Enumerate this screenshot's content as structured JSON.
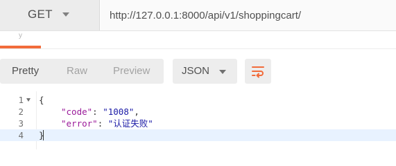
{
  "request": {
    "method": "GET",
    "url": "http://127.0.0.1:8000/api/v1/shoppingcart/"
  },
  "tabs": {
    "fragment": "y"
  },
  "toolbar": {
    "formats": [
      "Pretty",
      "Raw",
      "Preview"
    ],
    "active_format": "Pretty",
    "language": "JSON"
  },
  "icons": {
    "method_caret": "chevron-down-icon",
    "lang_caret": "chevron-down-icon",
    "wrap": "wrap-lines-icon",
    "fold": "fold-caret-icon"
  },
  "colors": {
    "accent": "#f26b3a",
    "json_key": "#9a1a9a",
    "json_string": "#1a1aa6",
    "active_line": "#e8f2ff"
  },
  "code": {
    "line_numbers": [
      "1",
      "2",
      "3",
      "4"
    ],
    "open_brace": "{",
    "close_brace": "}",
    "lines": [
      {
        "key": "\"code\"",
        "sep": ": ",
        "value": "\"1008\"",
        "trail": ","
      },
      {
        "key": "\"error\"",
        "sep": ": ",
        "value": "\"认证失败\"",
        "trail": ""
      }
    ]
  }
}
